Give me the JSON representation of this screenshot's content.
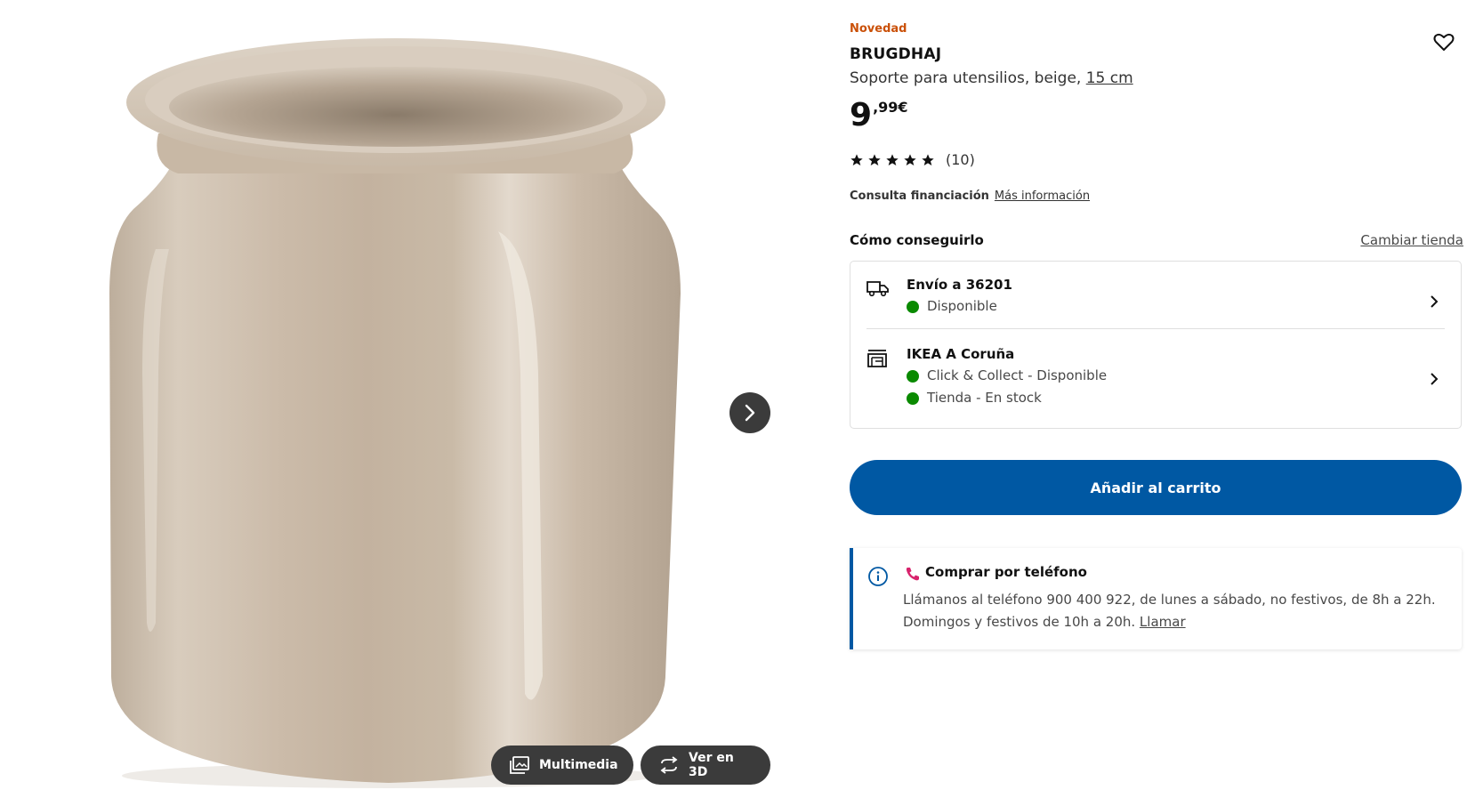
{
  "media": {
    "image_alt": "Soporte para utensilios beige",
    "multimedia_label": "Multimedia",
    "view3d_label": "Ver en 3D",
    "icons": {
      "next": "chevron-right-icon",
      "multimedia": "gallery-icon",
      "view3d": "rotate-3d-icon"
    }
  },
  "product": {
    "badge": "Novedad",
    "name": "BRUGDHAJ",
    "description": "Soporte para utensilios, beige, ",
    "size": "15 cm",
    "price_int": "9",
    "price_dec": ",99€",
    "rating": 5,
    "rating_count": "(10)",
    "finance_label": "Consulta financiación",
    "finance_link": "Más información"
  },
  "availability": {
    "title": "Cómo conseguirlo",
    "change_store": "Cambiar tienda",
    "delivery": {
      "head": "Envío a 36201",
      "lines": [
        "Disponible"
      ]
    },
    "store": {
      "head": "IKEA A Coruña",
      "lines": [
        "Click & Collect - Disponible",
        "Tienda - En stock"
      ]
    }
  },
  "cart": {
    "label": "Añadir al carrito"
  },
  "phone": {
    "title": "Comprar por teléfono",
    "body": "Llámanos al teléfono 900 400 922, de lunes a sábado, no festivos, de 8h a 22h. Domingos y festivos de 10h a 20h. ",
    "call_link": "Llamar"
  },
  "colors": {
    "brand_blue": "#0058a3",
    "badge_orange": "#ca5008",
    "available_green": "#0a8a00",
    "jar_beige": "#cdbfae"
  }
}
